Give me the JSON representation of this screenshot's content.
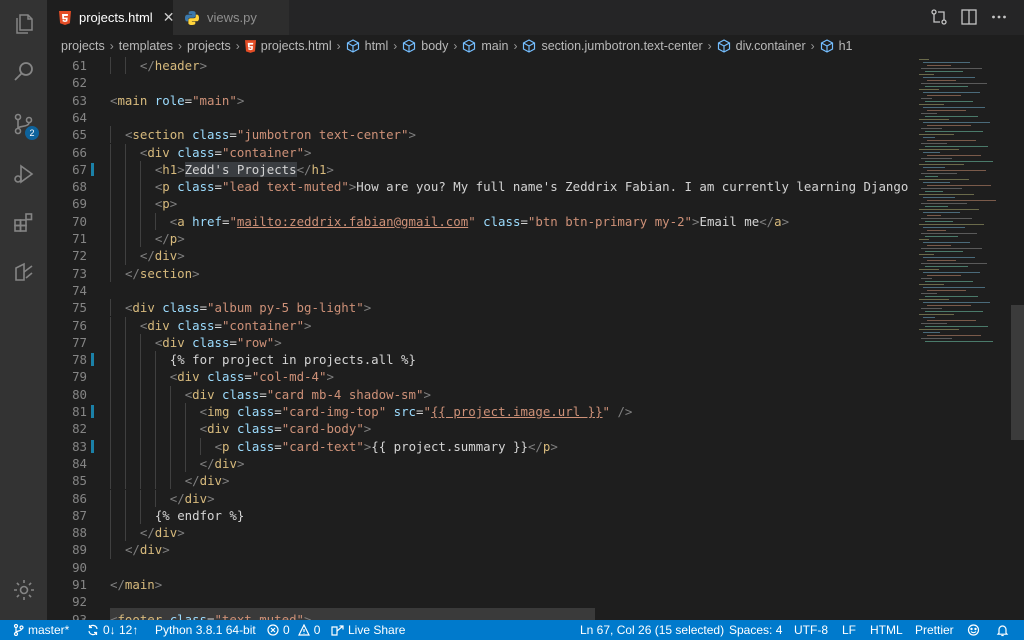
{
  "tabs": [
    {
      "label": "projects.html",
      "icon": "html5-icon",
      "active": true
    },
    {
      "label": "views.py",
      "icon": "python-icon",
      "active": false
    }
  ],
  "breadcrumb": [
    "projects",
    "templates",
    "projects",
    "projects.html",
    "html",
    "body",
    "main",
    "section.jumbotron.text-center",
    "div.container",
    "h1"
  ],
  "activity": {
    "scm_badge": "2"
  },
  "editor": {
    "lines": [
      {
        "n": "61",
        "indent": 2,
        "tokens": [
          [
            "br",
            "</"
          ],
          [
            "tag",
            "header"
          ],
          [
            "br",
            ">"
          ]
        ]
      },
      {
        "n": "62",
        "indent": 0,
        "tokens": []
      },
      {
        "n": "63",
        "indent": 0,
        "tokens": [
          [
            "br",
            "<"
          ],
          [
            "tag",
            "main "
          ],
          [
            "at",
            "role"
          ],
          [
            "tx",
            "="
          ],
          [
            "st",
            "\"main\""
          ],
          [
            "br",
            ">"
          ]
        ]
      },
      {
        "n": "64",
        "indent": 0,
        "tokens": []
      },
      {
        "n": "65",
        "indent": 1,
        "tokens": [
          [
            "br",
            "<"
          ],
          [
            "tag",
            "section "
          ],
          [
            "at",
            "class"
          ],
          [
            "tx",
            "="
          ],
          [
            "st",
            "\"jumbotron text-center\""
          ],
          [
            "br",
            ">"
          ]
        ]
      },
      {
        "n": "66",
        "indent": 2,
        "tokens": [
          [
            "br",
            "<"
          ],
          [
            "tag",
            "div "
          ],
          [
            "at",
            "class"
          ],
          [
            "tx",
            "="
          ],
          [
            "st",
            "\"container\""
          ],
          [
            "br",
            ">"
          ]
        ]
      },
      {
        "n": "67",
        "indent": 3,
        "mod": true,
        "tokens": [
          [
            "br",
            "<"
          ],
          [
            "tag",
            "h1"
          ],
          [
            "br",
            ">"
          ],
          [
            "sel",
            "Zedd's Projects"
          ],
          [
            "br",
            "</"
          ],
          [
            "tag",
            "h1"
          ],
          [
            "br",
            ">"
          ]
        ]
      },
      {
        "n": "68",
        "indent": 3,
        "tokens": [
          [
            "br",
            "<"
          ],
          [
            "tag",
            "p "
          ],
          [
            "at",
            "class"
          ],
          [
            "tx",
            "="
          ],
          [
            "st",
            "\"lead text-muted\""
          ],
          [
            "br",
            ">"
          ],
          [
            "tx",
            "How are you? My full name's Zeddrix Fabian. I am currently learning Django as I make"
          ]
        ]
      },
      {
        "n": "69",
        "indent": 3,
        "tokens": [
          [
            "br",
            "<"
          ],
          [
            "tag",
            "p"
          ],
          [
            "br",
            ">"
          ]
        ]
      },
      {
        "n": "70",
        "indent": 4,
        "tokens": [
          [
            "br",
            "<"
          ],
          [
            "tag",
            "a "
          ],
          [
            "at",
            "href"
          ],
          [
            "tx",
            "="
          ],
          [
            "st",
            "\""
          ],
          [
            "url",
            "mailto:zeddrix.fabian@gmail.com"
          ],
          [
            "st",
            "\""
          ],
          [
            "tx",
            " "
          ],
          [
            "at",
            "class"
          ],
          [
            "tx",
            "="
          ],
          [
            "st",
            "\"btn btn-primary my-2\""
          ],
          [
            "br",
            ">"
          ],
          [
            "tx",
            "Email me"
          ],
          [
            "br",
            "</"
          ],
          [
            "tag",
            "a"
          ],
          [
            "br",
            ">"
          ]
        ]
      },
      {
        "n": "71",
        "indent": 3,
        "tokens": [
          [
            "br",
            "</"
          ],
          [
            "tag",
            "p"
          ],
          [
            "br",
            ">"
          ]
        ]
      },
      {
        "n": "72",
        "indent": 2,
        "tokens": [
          [
            "br",
            "</"
          ],
          [
            "tag",
            "div"
          ],
          [
            "br",
            ">"
          ]
        ]
      },
      {
        "n": "73",
        "indent": 1,
        "tokens": [
          [
            "br",
            "</"
          ],
          [
            "tag",
            "section"
          ],
          [
            "br",
            ">"
          ]
        ]
      },
      {
        "n": "74",
        "indent": 0,
        "tokens": []
      },
      {
        "n": "75",
        "indent": 1,
        "tokens": [
          [
            "br",
            "<"
          ],
          [
            "tag",
            "div "
          ],
          [
            "at",
            "class"
          ],
          [
            "tx",
            "="
          ],
          [
            "st",
            "\"album py-5 bg-light\""
          ],
          [
            "br",
            ">"
          ]
        ]
      },
      {
        "n": "76",
        "indent": 2,
        "tokens": [
          [
            "br",
            "<"
          ],
          [
            "tag",
            "div "
          ],
          [
            "at",
            "class"
          ],
          [
            "tx",
            "="
          ],
          [
            "st",
            "\"container\""
          ],
          [
            "br",
            ">"
          ]
        ]
      },
      {
        "n": "77",
        "indent": 3,
        "tokens": [
          [
            "br",
            "<"
          ],
          [
            "tag",
            "div "
          ],
          [
            "at",
            "class"
          ],
          [
            "tx",
            "="
          ],
          [
            "st",
            "\"row\""
          ],
          [
            "br",
            ">"
          ]
        ]
      },
      {
        "n": "78",
        "indent": 4,
        "mod": true,
        "tokens": [
          [
            "tx",
            "{% for project in projects.all %}"
          ]
        ]
      },
      {
        "n": "79",
        "indent": 4,
        "tokens": [
          [
            "br",
            "<"
          ],
          [
            "tag",
            "div "
          ],
          [
            "at",
            "class"
          ],
          [
            "tx",
            "="
          ],
          [
            "st",
            "\"col-md-4\""
          ],
          [
            "br",
            ">"
          ]
        ]
      },
      {
        "n": "80",
        "indent": 5,
        "tokens": [
          [
            "br",
            "<"
          ],
          [
            "tag",
            "div "
          ],
          [
            "at",
            "class"
          ],
          [
            "tx",
            "="
          ],
          [
            "st",
            "\"card mb-4 shadow-sm\""
          ],
          [
            "br",
            ">"
          ]
        ]
      },
      {
        "n": "81",
        "indent": 6,
        "mod": true,
        "tokens": [
          [
            "br",
            "<"
          ],
          [
            "tag",
            "img "
          ],
          [
            "at",
            "class"
          ],
          [
            "tx",
            "="
          ],
          [
            "st",
            "\"card-img-top\""
          ],
          [
            "tx",
            " "
          ],
          [
            "at",
            "src"
          ],
          [
            "tx",
            "="
          ],
          [
            "st",
            "\""
          ],
          [
            "url",
            "{{ project.image.url }}"
          ],
          [
            "st",
            "\""
          ],
          [
            "tx",
            " "
          ],
          [
            "br",
            "/>"
          ]
        ]
      },
      {
        "n": "82",
        "indent": 6,
        "tokens": [
          [
            "br",
            "<"
          ],
          [
            "tag",
            "div "
          ],
          [
            "at",
            "class"
          ],
          [
            "tx",
            "="
          ],
          [
            "st",
            "\"card-body\""
          ],
          [
            "br",
            ">"
          ]
        ]
      },
      {
        "n": "83",
        "indent": 7,
        "mod": true,
        "tokens": [
          [
            "br",
            "<"
          ],
          [
            "tag",
            "p "
          ],
          [
            "at",
            "class"
          ],
          [
            "tx",
            "="
          ],
          [
            "st",
            "\"card-text\""
          ],
          [
            "br",
            ">"
          ],
          [
            "tx",
            "{{ project.summary }}"
          ],
          [
            "br",
            "</"
          ],
          [
            "tag",
            "p"
          ],
          [
            "br",
            ">"
          ]
        ]
      },
      {
        "n": "84",
        "indent": 6,
        "tokens": [
          [
            "br",
            "</"
          ],
          [
            "tag",
            "div"
          ],
          [
            "br",
            ">"
          ]
        ]
      },
      {
        "n": "85",
        "indent": 5,
        "tokens": [
          [
            "br",
            "</"
          ],
          [
            "tag",
            "div"
          ],
          [
            "br",
            ">"
          ]
        ]
      },
      {
        "n": "86",
        "indent": 4,
        "tokens": [
          [
            "br",
            "</"
          ],
          [
            "tag",
            "div"
          ],
          [
            "br",
            ">"
          ]
        ]
      },
      {
        "n": "87",
        "indent": 3,
        "tokens": [
          [
            "tx",
            "{% endfor %}"
          ]
        ]
      },
      {
        "n": "88",
        "indent": 2,
        "tokens": [
          [
            "br",
            "</"
          ],
          [
            "tag",
            "div"
          ],
          [
            "br",
            ">"
          ]
        ]
      },
      {
        "n": "89",
        "indent": 1,
        "tokens": [
          [
            "br",
            "</"
          ],
          [
            "tag",
            "div"
          ],
          [
            "br",
            ">"
          ]
        ]
      },
      {
        "n": "90",
        "indent": 0,
        "tokens": []
      },
      {
        "n": "91",
        "indent": 0,
        "tokens": [
          [
            "br",
            "</"
          ],
          [
            "tag",
            "main"
          ],
          [
            "br",
            ">"
          ]
        ]
      },
      {
        "n": "92",
        "indent": 0,
        "tokens": []
      },
      {
        "n": "93",
        "indent": 0,
        "tokens": [
          [
            "br",
            "<"
          ],
          [
            "tag",
            "footer "
          ],
          [
            "at",
            "class"
          ],
          [
            "tx",
            "="
          ],
          [
            "st",
            "\"text-muted\""
          ],
          [
            "br",
            ">"
          ]
        ]
      }
    ]
  },
  "status": {
    "branch": "master*",
    "sync": "0↓ 12↑",
    "python": "Python 3.8.1 64-bit",
    "errors": "0",
    "warnings": "0",
    "live_share": "Live Share",
    "cursor": "Ln 67, Col 26 (15 selected)",
    "spaces": "Spaces: 4",
    "encoding": "UTF-8",
    "eol": "LF",
    "language": "HTML",
    "formatter": "Prettier"
  },
  "colors": {
    "accent": "#007acc",
    "tag": "#d7ba7d",
    "attr": "#9cdcfe",
    "string": "#ce9178"
  }
}
